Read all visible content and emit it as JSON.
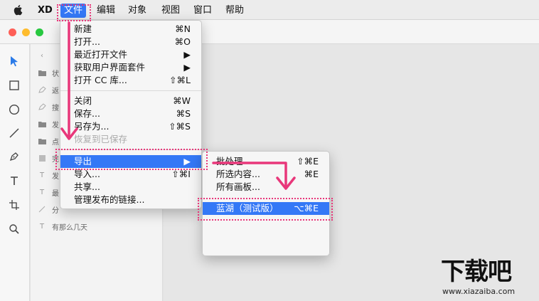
{
  "menubar": {
    "app_name": "XD",
    "items": [
      "文件",
      "编辑",
      "对象",
      "视图",
      "窗口",
      "帮助"
    ]
  },
  "layers": {
    "rows": [
      {
        "label": "状",
        "icon": "folder-icon"
      },
      {
        "label": "返",
        "icon": "pen-icon"
      },
      {
        "label": "搜",
        "icon": "pen-icon"
      },
      {
        "label": "发",
        "icon": "folder-icon"
      },
      {
        "label": "点",
        "icon": "folder-icon"
      },
      {
        "label": "完",
        "icon": "rectangle-icon"
      },
      {
        "label": "发",
        "icon": "text-icon"
      },
      {
        "label": "最",
        "icon": "text-icon"
      },
      {
        "label": "分",
        "icon": "line-icon"
      },
      {
        "label": "有那么几天",
        "icon": "text-icon"
      }
    ]
  },
  "file_menu": {
    "items": [
      {
        "label": "新建",
        "shortcut": "⌘N"
      },
      {
        "label": "打开...",
        "shortcut": "⌘O"
      },
      {
        "label": "最近打开文件",
        "shortcut": "▶"
      },
      {
        "label": "获取用户界面套件",
        "shortcut": "▶"
      },
      {
        "label": "打开 CC 库...",
        "shortcut": "⇧⌘L"
      },
      {
        "label": "关闭",
        "shortcut": "⌘W"
      },
      {
        "label": "保存...",
        "shortcut": "⌘S"
      },
      {
        "label": "另存为...",
        "shortcut": "⇧⌘S"
      },
      {
        "label": "恢复到已保存",
        "shortcut": ""
      },
      {
        "label": "导出",
        "shortcut": "▶"
      },
      {
        "label": "导入...",
        "shortcut": "⇧⌘I"
      },
      {
        "label": "共享...",
        "shortcut": ""
      },
      {
        "label": "管理发布的链接...",
        "shortcut": ""
      }
    ]
  },
  "export_menu": {
    "items": [
      {
        "label": "批处理",
        "shortcut": "⇧⌘E"
      },
      {
        "label": "所选内容...",
        "shortcut": "⌘E"
      },
      {
        "label": "所有画板...",
        "shortcut": ""
      },
      {
        "label": "蓝湖（测试版）",
        "shortcut": "⌥⌘E"
      }
    ]
  },
  "watermark": {
    "main": "下载吧",
    "sub": "www.xiazaiba.com"
  },
  "colors": {
    "highlight": "#3478f6",
    "annotation": "#e8377a"
  }
}
